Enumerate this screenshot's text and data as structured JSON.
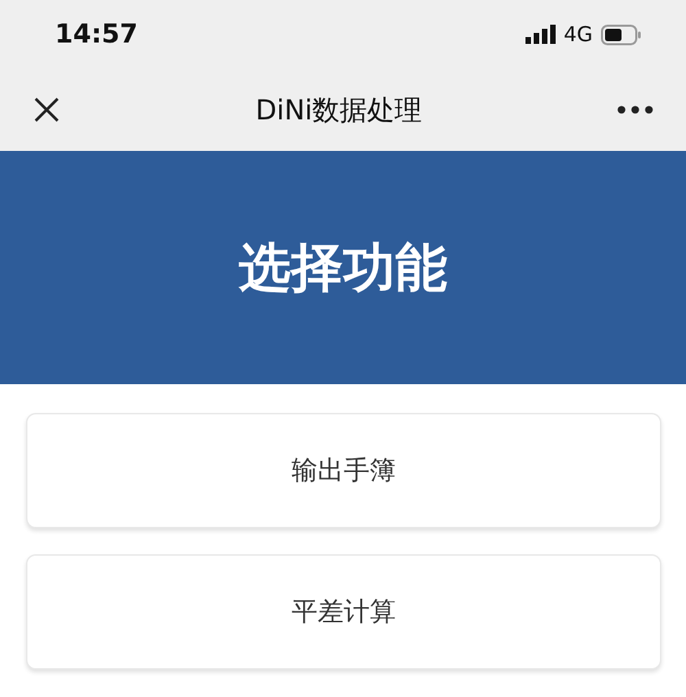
{
  "status_bar": {
    "time": "14:57",
    "network": "4G"
  },
  "nav_bar": {
    "title": "DiNi数据处理"
  },
  "banner": {
    "title": "选择功能"
  },
  "buttons": [
    {
      "label": "输出手簿"
    },
    {
      "label": "平差计算"
    }
  ]
}
